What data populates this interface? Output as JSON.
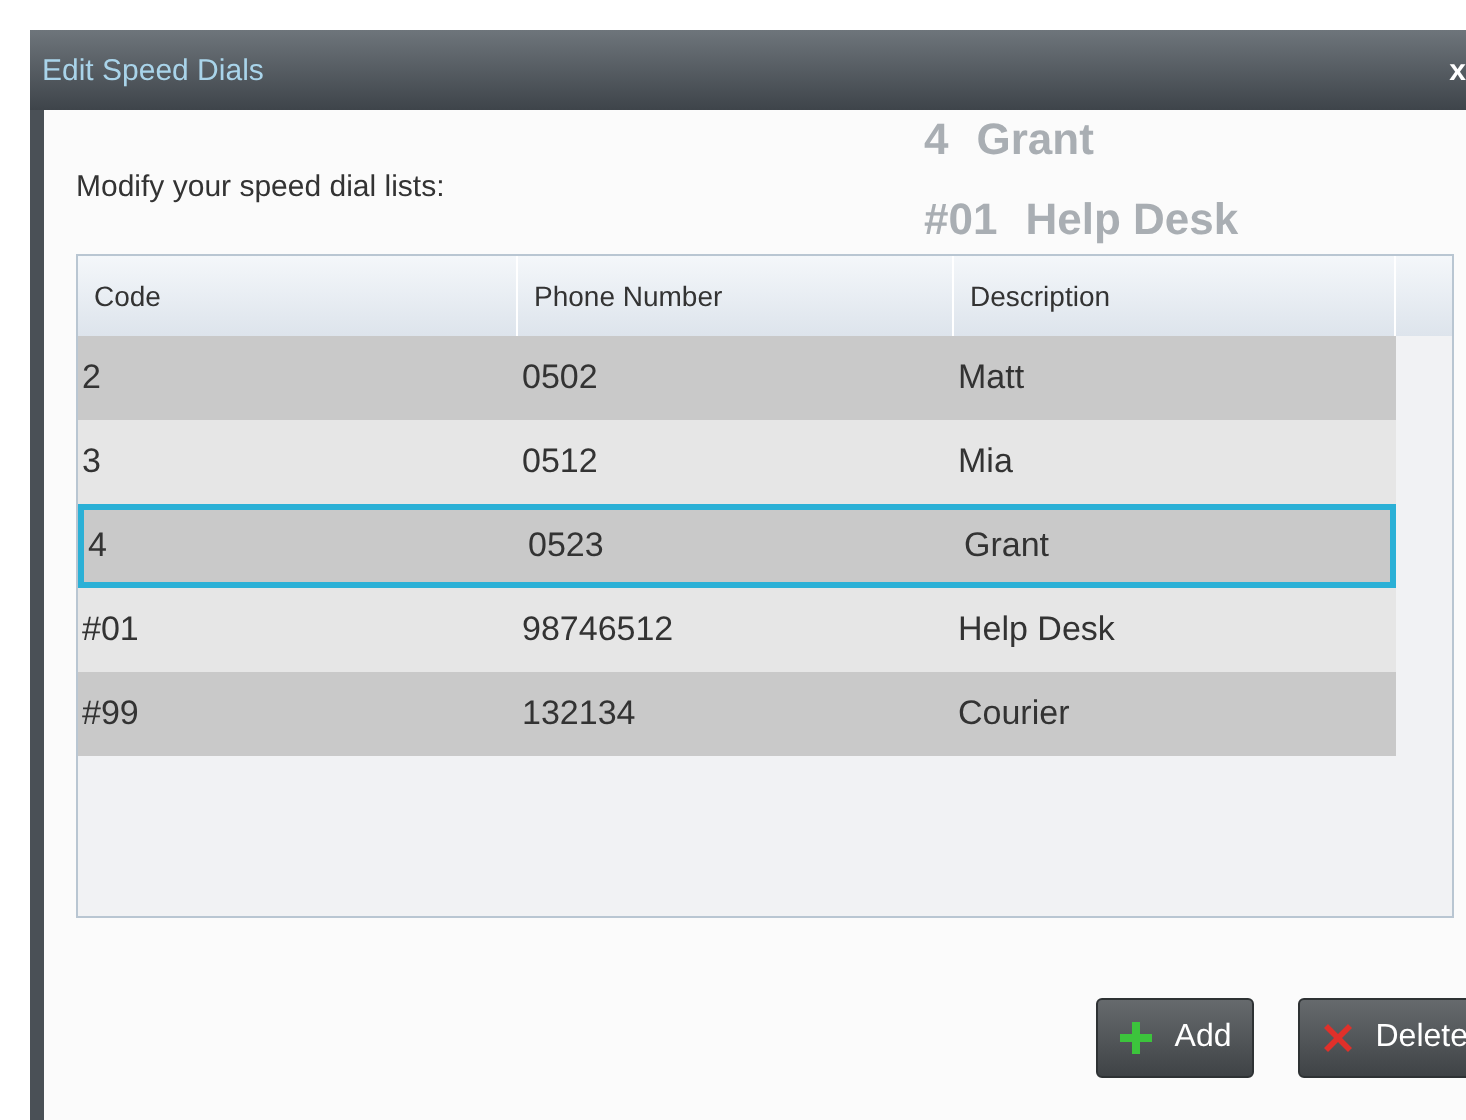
{
  "background_list": [
    {
      "code": "4",
      "name": "Grant"
    },
    {
      "code": "#01",
      "name": "Help Desk"
    }
  ],
  "dialog": {
    "title": "Edit Speed Dials",
    "close": "x",
    "prompt": "Modify your speed dial lists:"
  },
  "table": {
    "columns": [
      "Code",
      "Phone Number",
      "Description"
    ],
    "rows": [
      {
        "cells": [
          "2",
          "0502",
          "Matt"
        ],
        "selected": false
      },
      {
        "cells": [
          "3",
          "0512",
          "Mia"
        ],
        "selected": false
      },
      {
        "cells": [
          "4",
          "0523",
          "Grant"
        ],
        "selected": true
      },
      {
        "cells": [
          "#01",
          "98746512",
          "Help Desk"
        ],
        "selected": false
      },
      {
        "cells": [
          "#99",
          "132134",
          "Courier"
        ],
        "selected": false
      }
    ]
  },
  "buttons": [
    {
      "kind": "add",
      "label": "Add"
    },
    {
      "kind": "delete",
      "label": "Delete"
    }
  ]
}
